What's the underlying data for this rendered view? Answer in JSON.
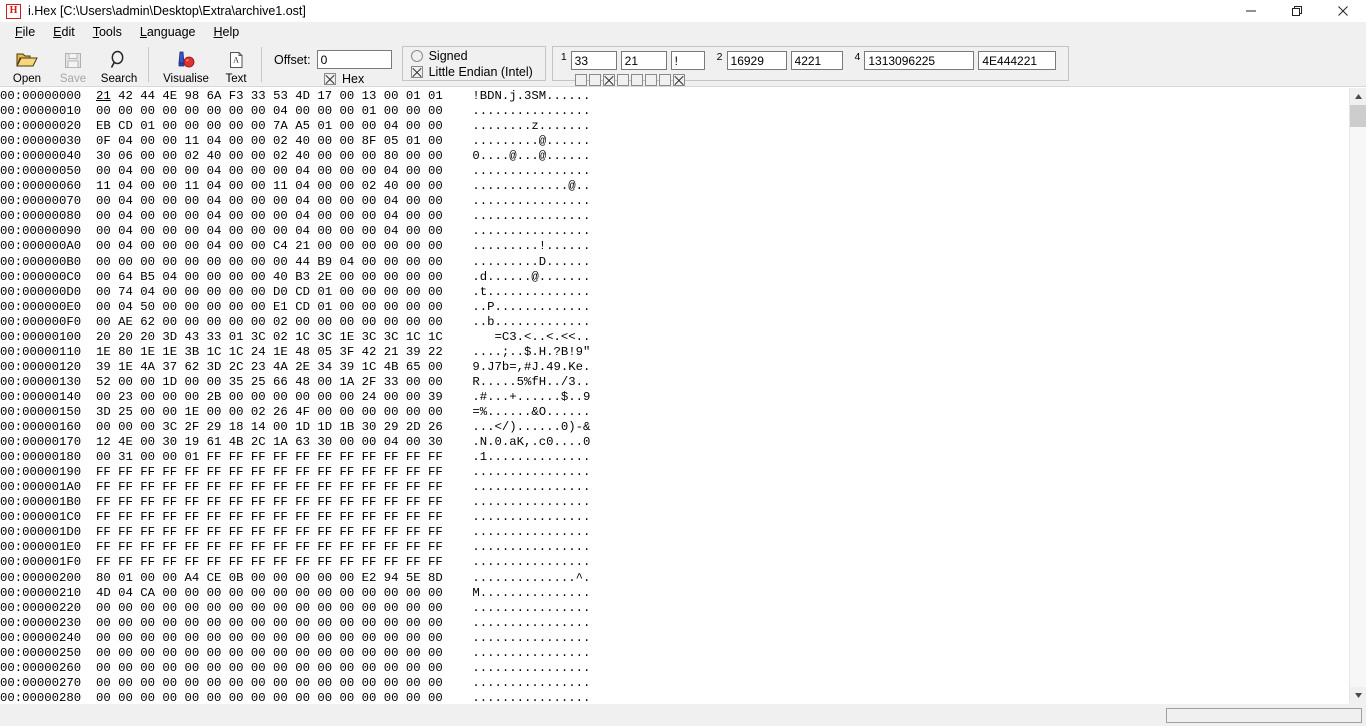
{
  "window": {
    "logo_letter": "H",
    "title": "i.Hex [C:\\Users\\admin\\Desktop\\Extra\\archive1.ost]",
    "minimize_label": "minimize",
    "maximize_label": "maximize",
    "close_label": "close"
  },
  "menubar": {
    "items": [
      {
        "label": "File",
        "accel": "F"
      },
      {
        "label": "Edit",
        "accel": "E"
      },
      {
        "label": "Tools",
        "accel": "T"
      },
      {
        "label": "Language",
        "accel": "L"
      },
      {
        "label": "Help",
        "accel": "H"
      }
    ]
  },
  "toolbar": {
    "buttons": [
      {
        "label": "Open",
        "icon": "open-folder-icon",
        "disabled": false
      },
      {
        "label": "Save",
        "icon": "floppy-disk-icon",
        "disabled": true
      },
      {
        "label": "Search",
        "icon": "magnifier-icon",
        "disabled": false
      },
      {
        "label": "Visualise",
        "icon": "visualise-icon",
        "disabled": false
      },
      {
        "label": "Text",
        "icon": "text-page-icon",
        "disabled": false
      }
    ],
    "offset": {
      "label": "Offset:",
      "value": "0",
      "placeholder": "",
      "hex_label": "Hex",
      "hex_checked": true
    },
    "options": {
      "signed_label": "Signed",
      "signed_checked": false,
      "endian_label": "Little Endian (Intel)",
      "endian_checked": true
    },
    "values": {
      "group1_index": "1",
      "byte_dec": "33",
      "byte_hex": "21",
      "byte_char": "!",
      "group2_index": "2",
      "word_dec": "16929",
      "word_hex": "4221",
      "group4_index": "4",
      "dword_dec": "1313096225",
      "dword_hex": "4E444221",
      "bits": [
        false,
        false,
        true,
        false,
        false,
        false,
        false,
        true
      ]
    }
  },
  "hex": {
    "rows": [
      {
        "offset": "00:00000000",
        "bytes": "21 42 44 4E 98 6A F3 33 53 4D 17 00 13 00 01 01",
        "ascii": "!BDN.j.3SM......",
        "selected_byte_index": 0
      },
      {
        "offset": "00:00000010",
        "bytes": "00 00 00 00 00 00 00 00 04 00 00 00 01 00 00 00",
        "ascii": "................"
      },
      {
        "offset": "00:00000020",
        "bytes": "EB CD 01 00 00 00 00 00 7A A5 01 00 00 04 00 00",
        "ascii": "........z......."
      },
      {
        "offset": "00:00000030",
        "bytes": "0F 04 00 00 11 04 00 00 02 40 00 00 8F 05 01 00",
        "ascii": ".........@......"
      },
      {
        "offset": "00:00000040",
        "bytes": "30 06 00 00 02 40 00 00 02 40 00 00 00 80 00 00",
        "ascii": "0....@...@......"
      },
      {
        "offset": "00:00000050",
        "bytes": "00 04 00 00 00 04 00 00 00 04 00 00 00 04 00 00",
        "ascii": "................"
      },
      {
        "offset": "00:00000060",
        "bytes": "11 04 00 00 11 04 00 00 11 04 00 00 02 40 00 00",
        "ascii": ".............@.."
      },
      {
        "offset": "00:00000070",
        "bytes": "00 04 00 00 00 04 00 00 00 04 00 00 00 04 00 00",
        "ascii": "................"
      },
      {
        "offset": "00:00000080",
        "bytes": "00 04 00 00 00 04 00 00 00 04 00 00 00 04 00 00",
        "ascii": "................"
      },
      {
        "offset": "00:00000090",
        "bytes": "00 04 00 00 00 04 00 00 00 04 00 00 00 04 00 00",
        "ascii": "................"
      },
      {
        "offset": "00:000000A0",
        "bytes": "00 04 00 00 00 04 00 00 C4 21 00 00 00 00 00 00",
        "ascii": ".........!......"
      },
      {
        "offset": "00:000000B0",
        "bytes": "00 00 00 00 00 00 00 00 00 44 B9 04 00 00 00 00",
        "ascii": ".........D......"
      },
      {
        "offset": "00:000000C0",
        "bytes": "00 64 B5 04 00 00 00 00 40 B3 2E 00 00 00 00 00",
        "ascii": ".d......@......."
      },
      {
        "offset": "00:000000D0",
        "bytes": "00 74 04 00 00 00 00 00 D0 CD 01 00 00 00 00 00",
        "ascii": ".t.............."
      },
      {
        "offset": "00:000000E0",
        "bytes": "00 04 50 00 00 00 00 00 E1 CD 01 00 00 00 00 00",
        "ascii": "..P............."
      },
      {
        "offset": "00:000000F0",
        "bytes": "00 AE 62 00 00 00 00 00 02 00 00 00 00 00 00 00",
        "ascii": "..b............."
      },
      {
        "offset": "00:00000100",
        "bytes": "20 20 20 3D 43 33 01 3C 02 1C 3C 1E 3C 3C 1C 1C",
        "ascii": "   =C3.<..<.<<.."
      },
      {
        "offset": "00:00000110",
        "bytes": "1E 80 1E 1E 3B 1C 1C 24 1E 48 05 3F 42 21 39 22",
        "ascii": "....;..$.H.?B!9\""
      },
      {
        "offset": "00:00000120",
        "bytes": "39 1E 4A 37 62 3D 2C 23 4A 2E 34 39 1C 4B 65 00",
        "ascii": "9.J7b=,#J.49.Ke."
      },
      {
        "offset": "00:00000130",
        "bytes": "52 00 00 1D 00 00 35 25 66 48 00 1A 2F 33 00 00",
        "ascii": "R.....5%fH../3.."
      },
      {
        "offset": "00:00000140",
        "bytes": "00 23 00 00 00 2B 00 00 00 00 00 00 24 00 00 39",
        "ascii": ".#...+......$..9"
      },
      {
        "offset": "00:00000150",
        "bytes": "3D 25 00 00 1E 00 00 02 26 4F 00 00 00 00 00 00",
        "ascii": "=%......&O......"
      },
      {
        "offset": "00:00000160",
        "bytes": "00 00 00 3C 2F 29 18 14 00 1D 1D 1B 30 29 2D 26",
        "ascii": "...</)......0)-&"
      },
      {
        "offset": "00:00000170",
        "bytes": "12 4E 00 30 19 61 4B 2C 1A 63 30 00 00 04 00 30",
        "ascii": ".N.0.aK,.c0....0"
      },
      {
        "offset": "00:00000180",
        "bytes": "00 31 00 00 01 FF FF FF FF FF FF FF FF FF FF FF",
        "ascii": ".1.............."
      },
      {
        "offset": "00:00000190",
        "bytes": "FF FF FF FF FF FF FF FF FF FF FF FF FF FF FF FF",
        "ascii": "................"
      },
      {
        "offset": "00:000001A0",
        "bytes": "FF FF FF FF FF FF FF FF FF FF FF FF FF FF FF FF",
        "ascii": "................"
      },
      {
        "offset": "00:000001B0",
        "bytes": "FF FF FF FF FF FF FF FF FF FF FF FF FF FF FF FF",
        "ascii": "................"
      },
      {
        "offset": "00:000001C0",
        "bytes": "FF FF FF FF FF FF FF FF FF FF FF FF FF FF FF FF",
        "ascii": "................"
      },
      {
        "offset": "00:000001D0",
        "bytes": "FF FF FF FF FF FF FF FF FF FF FF FF FF FF FF FF",
        "ascii": "................"
      },
      {
        "offset": "00:000001E0",
        "bytes": "FF FF FF FF FF FF FF FF FF FF FF FF FF FF FF FF",
        "ascii": "................"
      },
      {
        "offset": "00:000001F0",
        "bytes": "FF FF FF FF FF FF FF FF FF FF FF FF FF FF FF FF",
        "ascii": "................"
      },
      {
        "offset": "00:00000200",
        "bytes": "80 01 00 00 A4 CE 0B 00 00 00 00 00 E2 94 5E 8D",
        "ascii": "..............^."
      },
      {
        "offset": "00:00000210",
        "bytes": "4D 04 CA 00 00 00 00 00 00 00 00 00 00 00 00 00",
        "ascii": "M..............."
      },
      {
        "offset": "00:00000220",
        "bytes": "00 00 00 00 00 00 00 00 00 00 00 00 00 00 00 00",
        "ascii": "................"
      },
      {
        "offset": "00:00000230",
        "bytes": "00 00 00 00 00 00 00 00 00 00 00 00 00 00 00 00",
        "ascii": "................"
      },
      {
        "offset": "00:00000240",
        "bytes": "00 00 00 00 00 00 00 00 00 00 00 00 00 00 00 00",
        "ascii": "................"
      },
      {
        "offset": "00:00000250",
        "bytes": "00 00 00 00 00 00 00 00 00 00 00 00 00 00 00 00",
        "ascii": "................"
      },
      {
        "offset": "00:00000260",
        "bytes": "00 00 00 00 00 00 00 00 00 00 00 00 00 00 00 00",
        "ascii": "................"
      },
      {
        "offset": "00:00000270",
        "bytes": "00 00 00 00 00 00 00 00 00 00 00 00 00 00 00 00",
        "ascii": "................"
      },
      {
        "offset": "00:00000280",
        "bytes": "00 00 00 00 00 00 00 00 00 00 00 00 00 00 00 00",
        "ascii": "................"
      }
    ]
  },
  "scrollbars": {
    "vertical_up_icon": "chevron-up-icon",
    "vertical_down_icon": "chevron-down-icon"
  },
  "colors": {
    "accent_red": "#d01b1b",
    "chrome_gray": "#f0f0f0",
    "text": "#000000"
  }
}
